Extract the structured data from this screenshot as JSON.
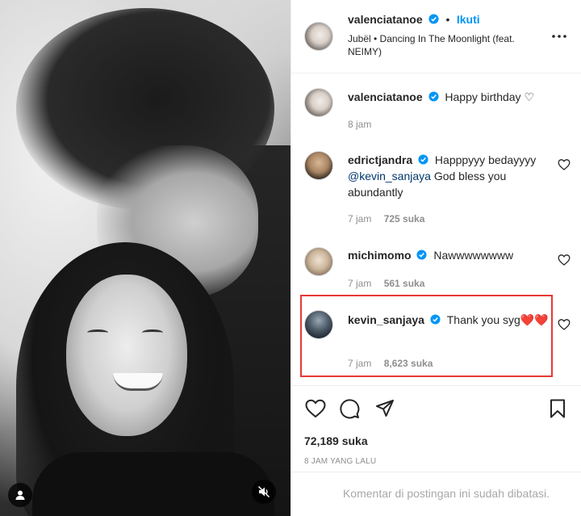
{
  "post": {
    "author": "valenciatanoe",
    "follow_label": "Ikuti",
    "separator": "•",
    "audio": "Jubël • Dancing In The Moonlight (feat. NEIMY)"
  },
  "comments": [
    {
      "user": "valenciatanoe",
      "verified": true,
      "text": "Happy birthday ♡",
      "time": "8 jam",
      "likes": ""
    },
    {
      "user": "edrictjandra",
      "verified": true,
      "text_pre": "Happpyyy bedayyyy",
      "mention": "@kevin_sanjaya",
      "text_post": "God bless you abundantly",
      "time": "7 jam",
      "likes": "725 suka"
    },
    {
      "user": "michimomo",
      "verified": true,
      "text": "Nawwwwwwww",
      "time": "7 jam",
      "likes": "561 suka"
    },
    {
      "user": "kevin_sanjaya",
      "verified": true,
      "text": "Thank you syg❤️❤️",
      "time": "7 jam",
      "likes": "8,623 suka"
    }
  ],
  "footer": {
    "likes_total": "72,189 suka",
    "posted_ago": "8 JAM YANG LALU",
    "comments_limited": "Komentar di postingan ini sudah dibatasi."
  },
  "colors": {
    "accent": "#0095f6",
    "highlight": "#e53935",
    "heart": "#ed1c24"
  },
  "icons": [
    "user-tag-icon",
    "mute-icon",
    "more-icon",
    "heart-icon",
    "comment-icon",
    "share-icon",
    "bookmark-icon",
    "verified-icon"
  ]
}
